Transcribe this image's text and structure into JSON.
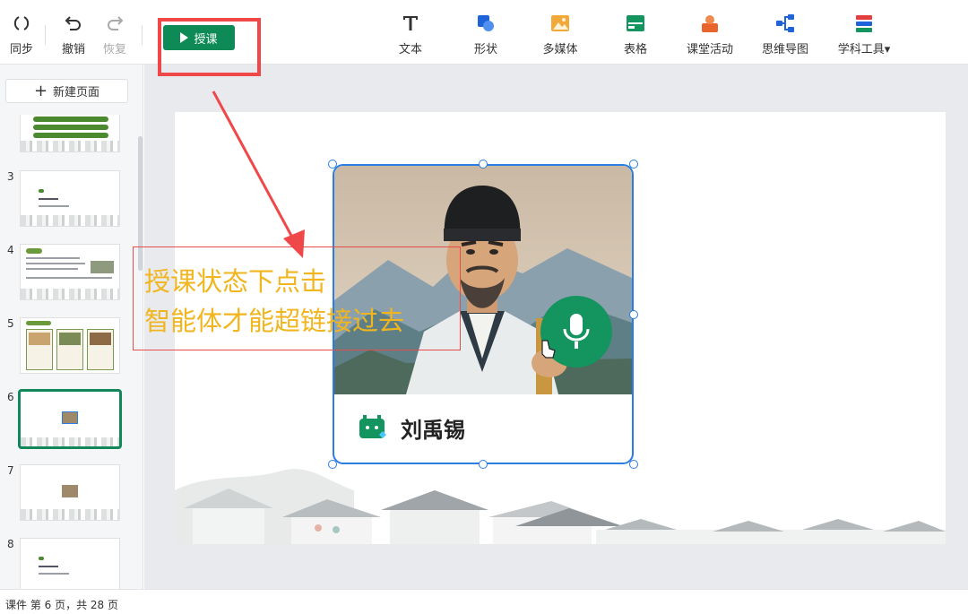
{
  "toolbar": {
    "sync_label": "同步",
    "undo_label": "撤销",
    "redo_label": "恢复",
    "teach_label": "授课",
    "tools": [
      {
        "label": "文本",
        "icon": "text-icon"
      },
      {
        "label": "形状",
        "icon": "shape-icon"
      },
      {
        "label": "多媒体",
        "icon": "media-icon"
      },
      {
        "label": "表格",
        "icon": "table-icon"
      },
      {
        "label": "课堂活动",
        "icon": "activity-icon"
      },
      {
        "label": "思维导图",
        "icon": "mindmap-icon"
      },
      {
        "label": "学科工具▾",
        "icon": "subject-tools-icon"
      }
    ]
  },
  "sidebar": {
    "new_page_label": "新建页面",
    "thumbnails": [
      {
        "number": "3"
      },
      {
        "number": "4"
      },
      {
        "number": "5"
      },
      {
        "number": "6",
        "active": true
      },
      {
        "number": "7"
      },
      {
        "number": "8"
      }
    ]
  },
  "slide": {
    "agent_name": "刘禹锡"
  },
  "annotation": {
    "line1": "授课状态下点击",
    "line2": "智能体才能超链接过去"
  },
  "status_bar": {
    "text": "课件 第 6 页，共 28 页"
  },
  "colors": {
    "teach_button": "#0d8a55",
    "highlight_red": "#f04848",
    "annotation_text": "#f1b61f",
    "selection_blue": "#2b7de1",
    "active_thumb": "#11875a"
  }
}
